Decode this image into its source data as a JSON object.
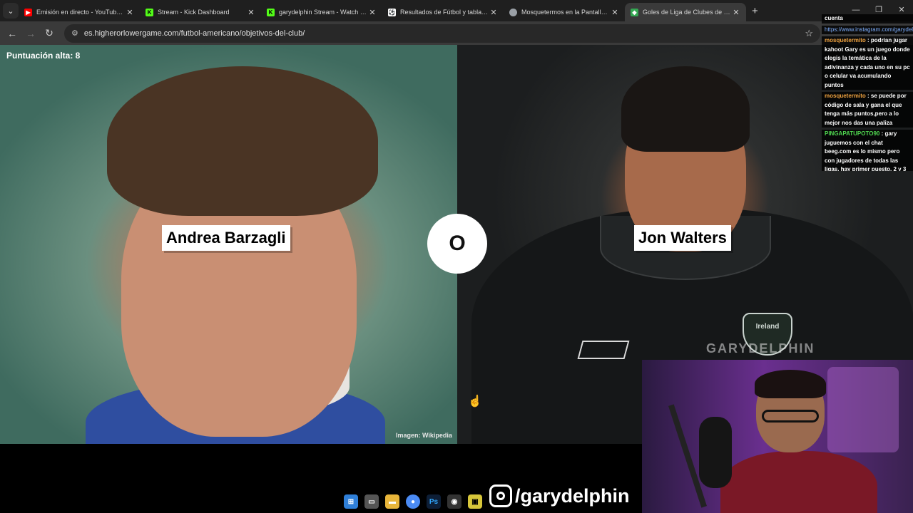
{
  "browser": {
    "tabs": [
      {
        "title": "Emisión en directo - YouTube Studio",
        "favicon": "youtube-icon",
        "color": "#ff0000",
        "active": false
      },
      {
        "title": "Stream - Kick Dashboard",
        "favicon": "kick-icon",
        "color": "#53fc18",
        "active": false
      },
      {
        "title": "garydelphin Stream - Watch Live on Kick",
        "favicon": "kick-icon",
        "color": "#53fc18",
        "active": false
      },
      {
        "title": "Resultados de Fútbol y tabla de posiciones",
        "favicon": "scores-icon",
        "color": "#ffffff",
        "active": false
      },
      {
        "title": "Mosquetermos en la Pantalla INTRO",
        "favicon": "globe-icon",
        "color": "#9aa0a6",
        "active": false
      },
      {
        "title": "Goles de Liga de Clubes de Fútbol",
        "favicon": "game-icon",
        "color": "#34a853",
        "active": true
      }
    ],
    "tab_close_glyph": "✕",
    "new_tab_glyph": "+",
    "url": "es.higherorlowergame.com/futbol-americano/objetivos-del-club/"
  },
  "game": {
    "high_score": "Puntuación alta: 8",
    "left_player": "Andrea Barzagli",
    "right_player": "Jon Walters",
    "vs_text": "O",
    "image_credit": "Imagen: Wikipedia",
    "crest_text": "Ireland"
  },
  "overlay": {
    "watermark": "GARYDELPHIN",
    "social_handle": "/garydelphin"
  },
  "chat": {
    "messages": [
      {
        "user": "",
        "text": "cuenta"
      },
      {
        "user": "",
        "text": "https://www.instagram.com/garydelphinfutbol"
      },
      {
        "user": "mosquetermito",
        "text": "podrían jugar kahoot Gary es un juego donde elegis la temática de la adivinanza y cada uno en su pc o celular va acumulando puntos"
      },
      {
        "user": "mosquetermito",
        "text": "se puede por código de sala y gana el que tenga más puntos,pero a lo mejor nos das una paliza"
      },
      {
        "user": "PINGAPATUPOTO90",
        "text": "gary juguemos con el chat beeg.com es lo mismo pero con jugadores de todas las ligas, hay primer puesto, 2 y 3"
      }
    ]
  },
  "colors": {
    "browser_bg": "#1f1f1f",
    "toolbar_bg": "#3a3a3a",
    "label_bg": "#ffffff"
  }
}
